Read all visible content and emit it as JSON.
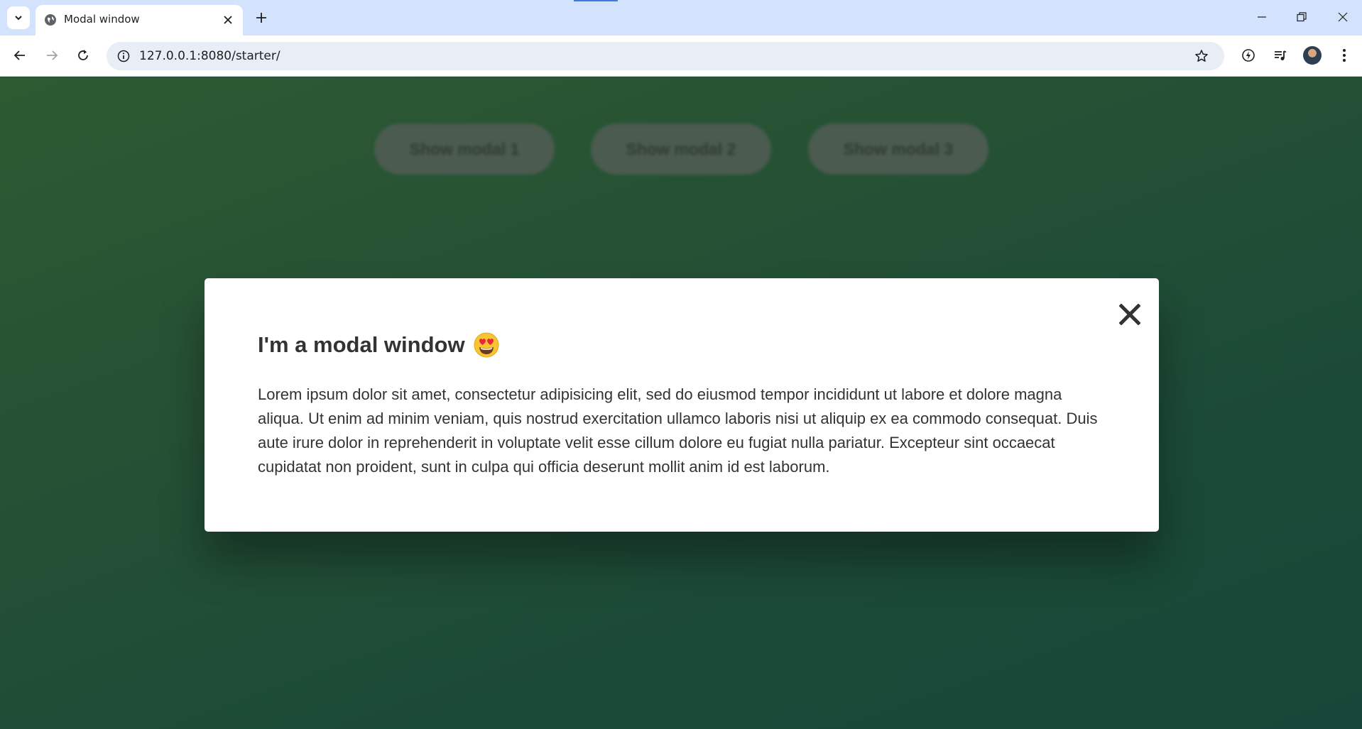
{
  "browser": {
    "tab_title": "Modal window",
    "url": "127.0.0.1:8080/starter/"
  },
  "page": {
    "buttons": [
      {
        "label": "Show modal 1"
      },
      {
        "label": "Show modal 2"
      },
      {
        "label": "Show modal 3"
      }
    ],
    "modal": {
      "title": "I'm a modal window",
      "emoji_icon": "heart-eyes-emoji-icon",
      "body": "Lorem ipsum dolor sit amet, consectetur adipisicing elit, sed do eiusmod tempor incididunt ut labore et dolore magna aliqua. Ut enim ad minim veniam, quis nostrud exercitation ullamco laboris nisi ut aliquip ex ea commodo consequat. Duis aute irure dolor in reprehenderit in voluptate velit esse cillum dolore eu fugiat nulla pariatur. Excepteur sint occaecat cupidatat non proident, sunt in culpa qui officia deserunt mollit anim id est laborum.",
      "close_icon": "close-icon"
    }
  },
  "colors": {
    "background_gradient_start": "#2e5a32",
    "background_gradient_end": "#164738",
    "modal_text": "#333333",
    "button_bg": "#4b5b50"
  }
}
